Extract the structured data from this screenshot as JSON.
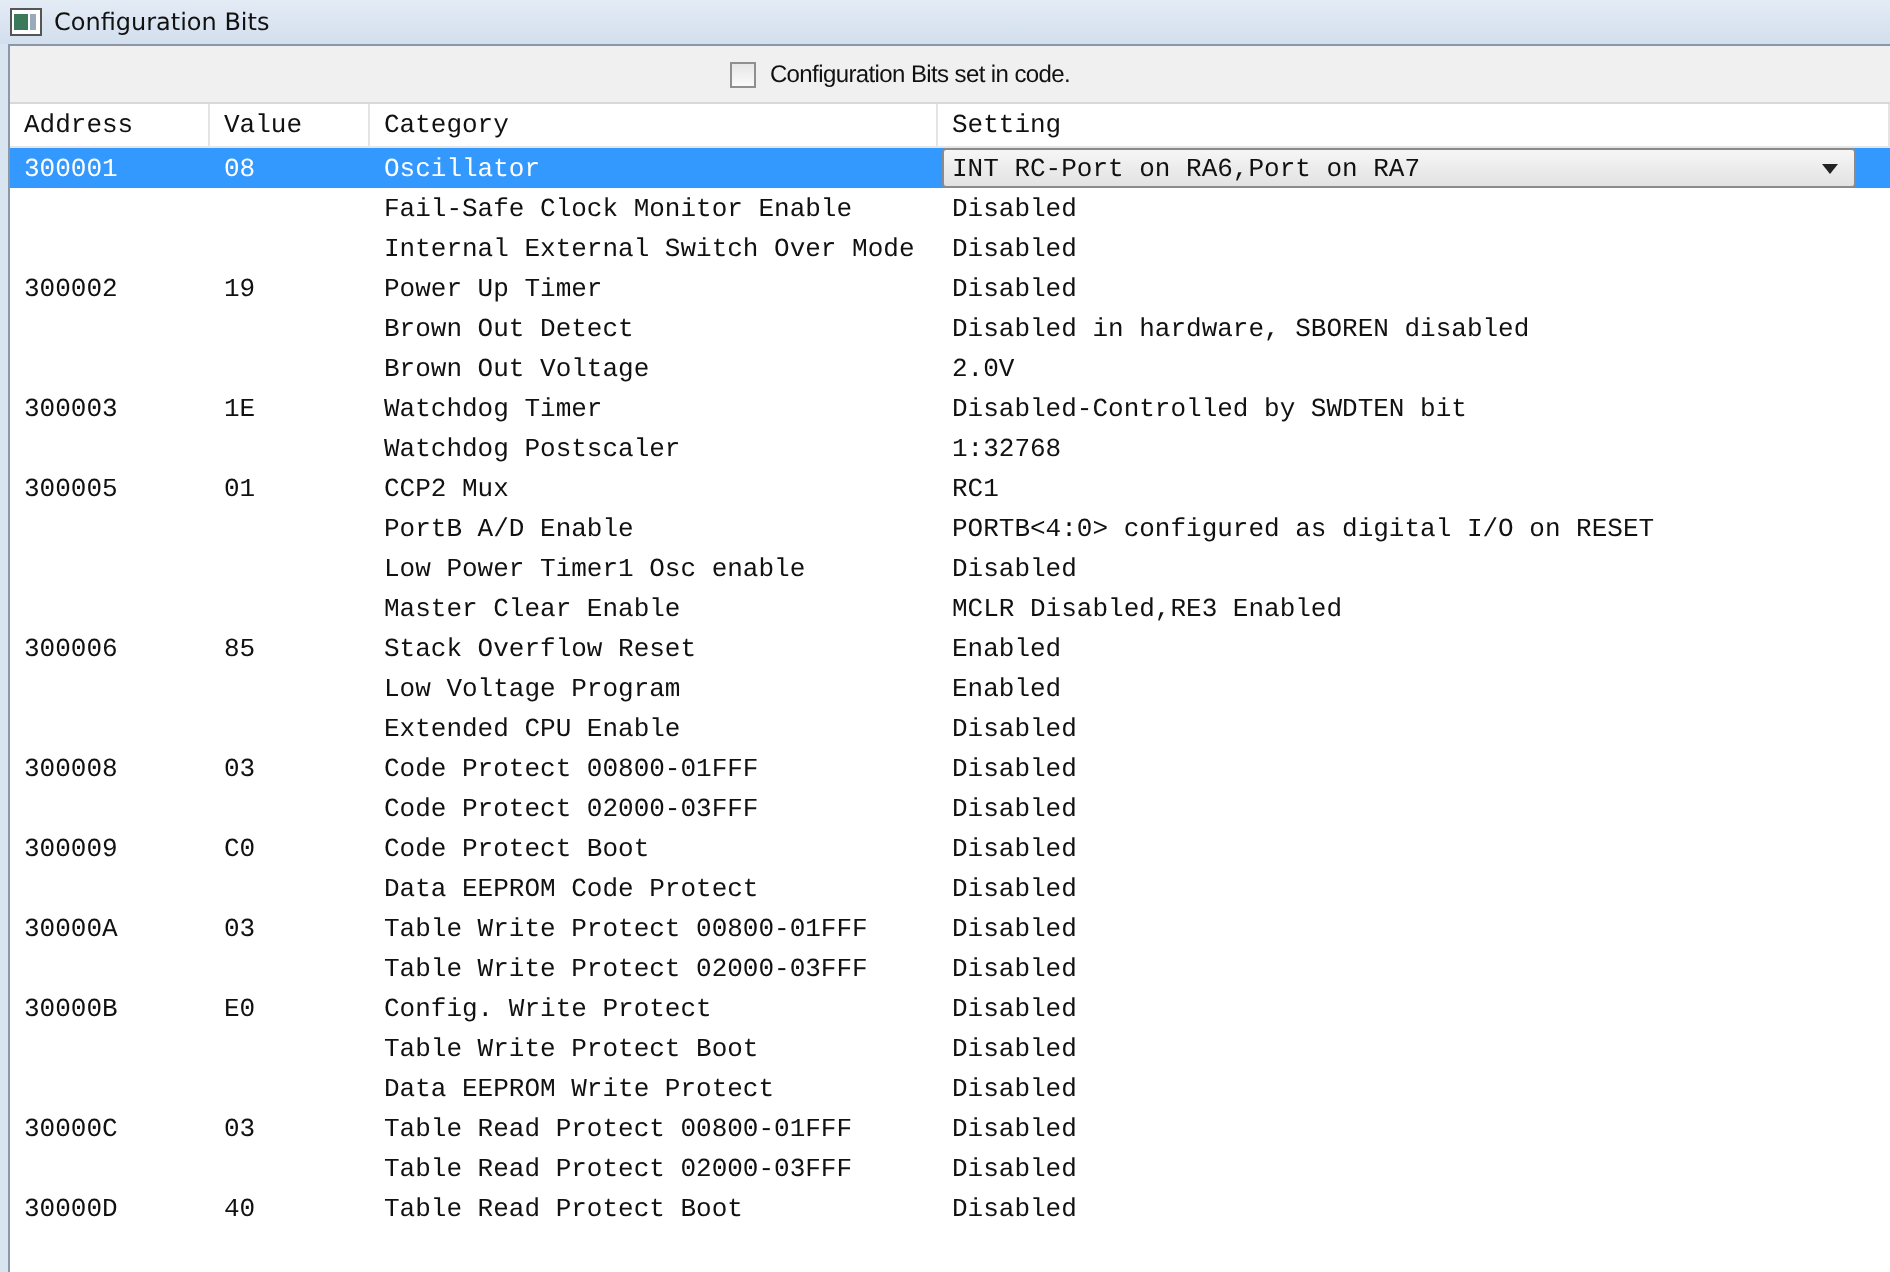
{
  "window": {
    "title": "Configuration Bits"
  },
  "toolbar": {
    "checkbox": {
      "label": "Configuration Bits set in code.",
      "checked": false
    }
  },
  "table": {
    "columns": [
      "Address",
      "Value",
      "Category",
      "Setting"
    ],
    "rows": [
      {
        "address": "300001",
        "value": "08",
        "category": "Oscillator",
        "setting": "INT RC-Port on RA6,Port on RA7",
        "kind": "dropdown",
        "selected": true
      },
      {
        "address": "",
        "value": "",
        "category": "Fail-Safe Clock Monitor Enable",
        "setting": "Disabled",
        "kind": "text",
        "selected": false
      },
      {
        "address": "",
        "value": "",
        "category": "Internal External Switch Over Mode",
        "setting": "Disabled",
        "kind": "text",
        "selected": false
      },
      {
        "address": "300002",
        "value": "19",
        "category": "Power Up Timer",
        "setting": "Disabled",
        "kind": "text",
        "selected": false
      },
      {
        "address": "",
        "value": "",
        "category": "Brown Out Detect",
        "setting": "Disabled in hardware, SBOREN disabled",
        "kind": "text",
        "selected": false
      },
      {
        "address": "",
        "value": "",
        "category": "Brown Out Voltage",
        "setting": "2.0V",
        "kind": "text",
        "selected": false
      },
      {
        "address": "300003",
        "value": "1E",
        "category": "Watchdog Timer",
        "setting": "Disabled-Controlled by SWDTEN bit",
        "kind": "text",
        "selected": false
      },
      {
        "address": "",
        "value": "",
        "category": "Watchdog Postscaler",
        "setting": "1:32768",
        "kind": "text",
        "selected": false
      },
      {
        "address": "300005",
        "value": "01",
        "category": "CCP2 Mux",
        "setting": "RC1",
        "kind": "text",
        "selected": false
      },
      {
        "address": "",
        "value": "",
        "category": "PortB A/D Enable",
        "setting": "PORTB<4:0> configured as digital I/O on RESET",
        "kind": "text",
        "selected": false
      },
      {
        "address": "",
        "value": "",
        "category": "Low Power Timer1 Osc enable",
        "setting": "Disabled",
        "kind": "text",
        "selected": false
      },
      {
        "address": "",
        "value": "",
        "category": "Master Clear Enable",
        "setting": "MCLR Disabled,RE3 Enabled",
        "kind": "text",
        "selected": false
      },
      {
        "address": "300006",
        "value": "85",
        "category": "Stack Overflow Reset",
        "setting": "Enabled",
        "kind": "text",
        "selected": false
      },
      {
        "address": "",
        "value": "",
        "category": "Low Voltage Program",
        "setting": "Enabled",
        "kind": "text",
        "selected": false
      },
      {
        "address": "",
        "value": "",
        "category": "Extended CPU Enable",
        "setting": "Disabled",
        "kind": "text",
        "selected": false
      },
      {
        "address": "300008",
        "value": "03",
        "category": "Code Protect 00800-01FFF",
        "setting": "Disabled",
        "kind": "text",
        "selected": false
      },
      {
        "address": "",
        "value": "",
        "category": "Code Protect 02000-03FFF",
        "setting": "Disabled",
        "kind": "text",
        "selected": false
      },
      {
        "address": "300009",
        "value": "C0",
        "category": "Code Protect Boot",
        "setting": "Disabled",
        "kind": "text",
        "selected": false
      },
      {
        "address": "",
        "value": "",
        "category": "Data EEPROM Code Protect",
        "setting": "Disabled",
        "kind": "text",
        "selected": false
      },
      {
        "address": "30000A",
        "value": "03",
        "category": "Table Write Protect 00800-01FFF",
        "setting": "Disabled",
        "kind": "text",
        "selected": false
      },
      {
        "address": "",
        "value": "",
        "category": "Table Write Protect 02000-03FFF",
        "setting": "Disabled",
        "kind": "text",
        "selected": false
      },
      {
        "address": "30000B",
        "value": "E0",
        "category": "Config. Write Protect",
        "setting": "Disabled",
        "kind": "text",
        "selected": false
      },
      {
        "address": "",
        "value": "",
        "category": "Table Write Protect Boot",
        "setting": "Disabled",
        "kind": "text",
        "selected": false
      },
      {
        "address": "",
        "value": "",
        "category": "Data EEPROM Write Protect",
        "setting": "Disabled",
        "kind": "text",
        "selected": false
      },
      {
        "address": "30000C",
        "value": "03",
        "category": "Table Read Protect 00800-01FFF",
        "setting": "Disabled",
        "kind": "text",
        "selected": false
      },
      {
        "address": "",
        "value": "",
        "category": "Table Read Protect 02000-03FFF",
        "setting": "Disabled",
        "kind": "text",
        "selected": false
      },
      {
        "address": "30000D",
        "value": "40",
        "category": "Table Read Protect Boot",
        "setting": "Disabled",
        "kind": "text",
        "selected": false
      }
    ]
  }
}
